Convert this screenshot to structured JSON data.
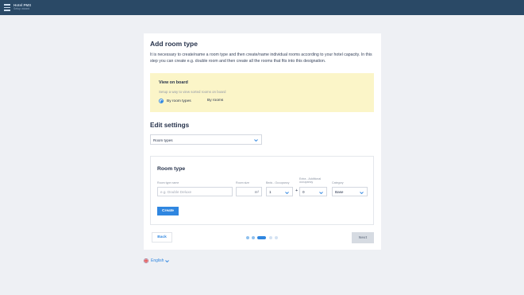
{
  "header": {
    "brand_name": "Hotel PMS",
    "brand_subtitle": "Setup wizard"
  },
  "page": {
    "title": "Add room type",
    "description": "It is necessary to create/name a room type and then create/name individual rooms according to your hotel capacity. In this step you can create e.g. double room and then create all the rooms that fits into this designation."
  },
  "view_on_board": {
    "title": "View on board",
    "hint": "Setup a way to view sorted rooms on board",
    "options": [
      {
        "label": "By room types",
        "selected": true
      },
      {
        "label": "By rooms",
        "selected": false
      }
    ]
  },
  "edit_settings": {
    "title": "Edit settings",
    "select_value": "Room types"
  },
  "room_type": {
    "title": "Room type",
    "name_label": "Room type name",
    "name_placeholder": "e.g. Double Deluxe",
    "size_label": "Room size",
    "size_unit": "m²",
    "beds_label": "Beds - Occupancy",
    "beds_value": "1",
    "plus": "+",
    "extra_label": "Extra - Additional occupancy",
    "extra_value": "0",
    "category_label": "Category",
    "category_value": "Base",
    "create_label": "Create"
  },
  "nav": {
    "back_label": "Back",
    "next_label": "Next",
    "steps_total": 5,
    "current_step": 3
  },
  "language": {
    "label": "English"
  },
  "colors": {
    "topbar": "#2a4966",
    "accent": "#2f86e0",
    "board_bg": "#fbf5c8",
    "step_done": "#8fc0ee",
    "step_todo": "#d3e2f2"
  },
  "icons": {
    "menu": "hamburger-menu-icon",
    "chevron": "chevron-down-icon",
    "flag": "uk-flag-icon"
  }
}
